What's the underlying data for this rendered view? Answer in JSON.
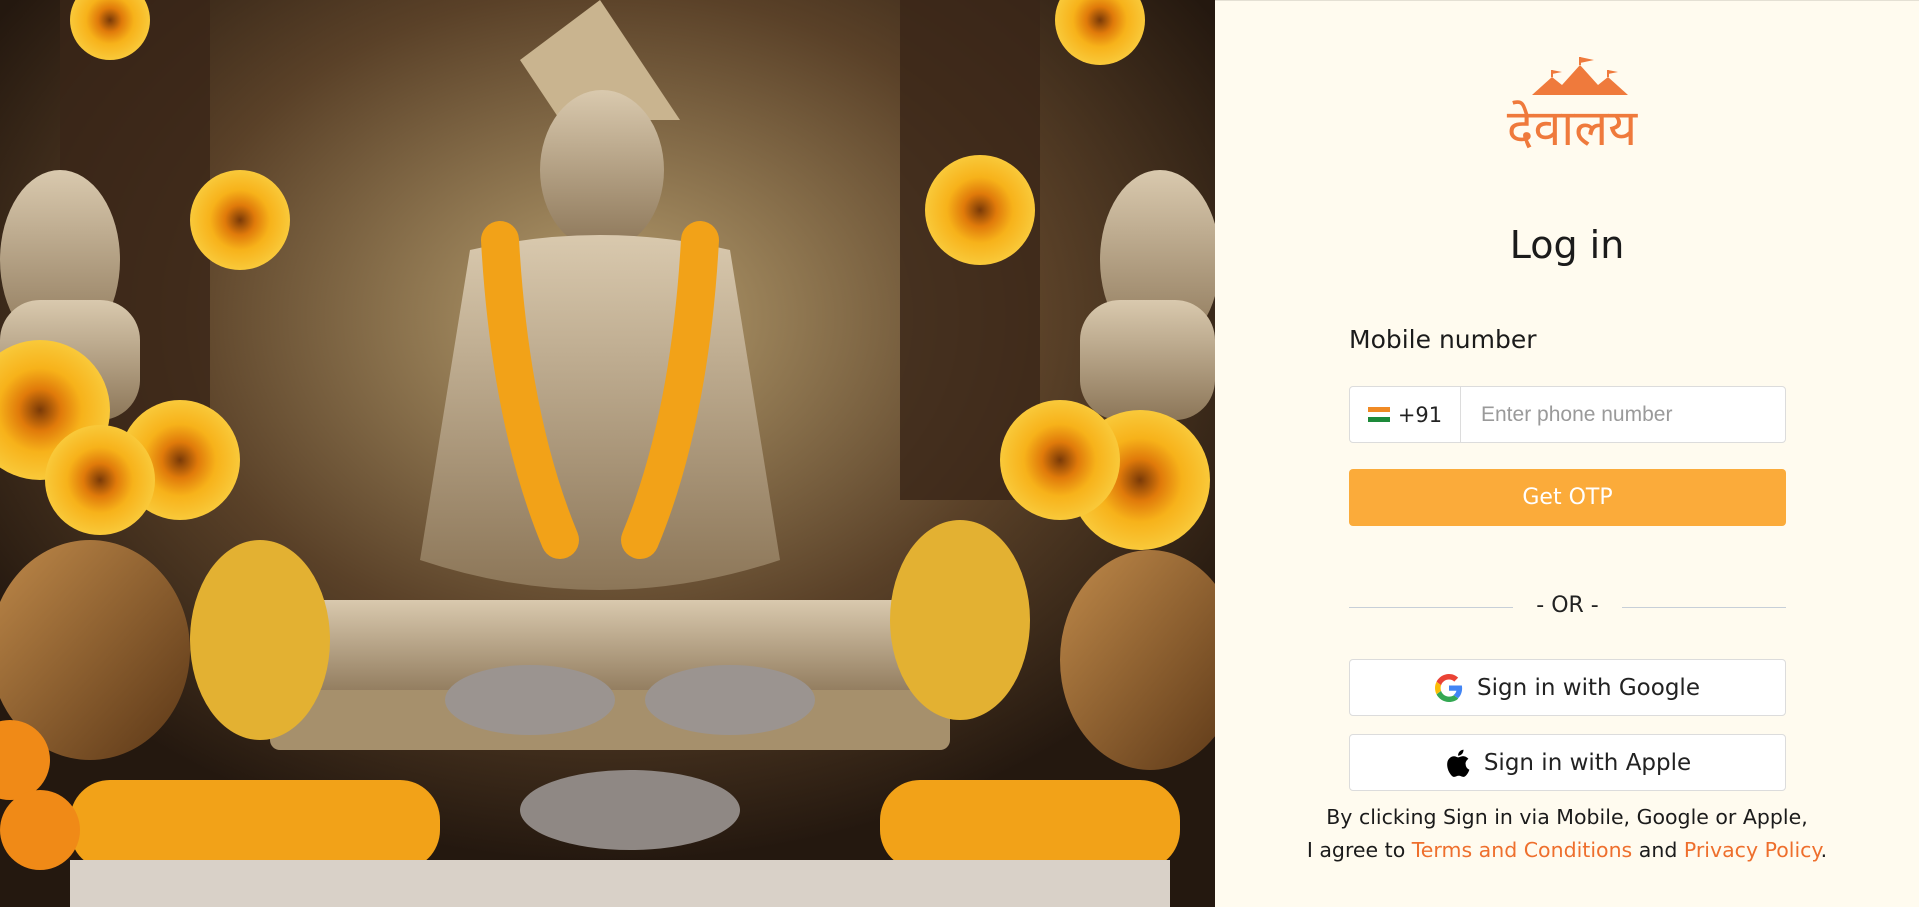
{
  "hero": {
    "image": "Temple idol statue decorated with marigold garlands, sunflowers and offerings"
  },
  "logo": {
    "text": "देवालय",
    "color": "#ef7a3c"
  },
  "login": {
    "title": "Log in",
    "mobile_label": "Mobile number",
    "country_code": "+91",
    "phone_placeholder": "Enter phone number",
    "get_otp": "Get OTP",
    "or_text": "- OR -",
    "google_label": "Sign in with Google",
    "apple_label": "Sign in with Apple",
    "terms_line1": "By clicking Sign in via Mobile, Google or Apple,",
    "terms_prefix": "I agree to ",
    "terms_link": "Terms and Conditions",
    "terms_and": " and ",
    "privacy_link": "Privacy Policy",
    "terms_end": "."
  },
  "colors": {
    "accent": "#fbab3a",
    "link": "#ee6f2d",
    "panel_bg": "#fffbef"
  }
}
